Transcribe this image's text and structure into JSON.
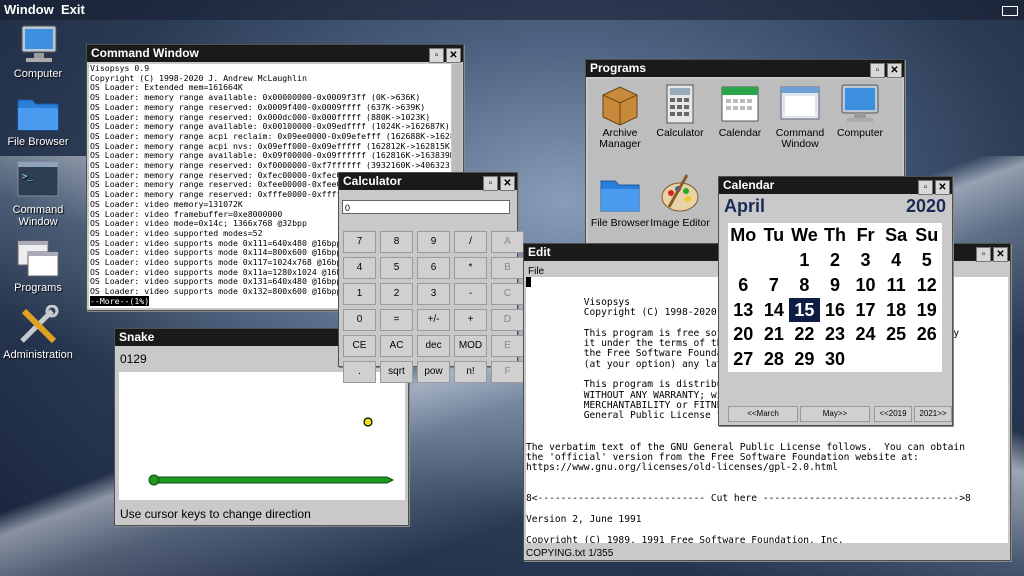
{
  "topbar": {
    "window_label": "Window",
    "exit_label": "Exit"
  },
  "desktop_icons": [
    {
      "label": "Computer"
    },
    {
      "label": "File Browser"
    },
    {
      "label": "Command Window"
    },
    {
      "label": "Programs"
    },
    {
      "label": "Administration"
    }
  ],
  "cmd": {
    "title": "Command Window",
    "lines": [
      "Visopsys 0.9",
      "Copyright (C) 1998-2020 J. Andrew McLaughlin",
      "OS Loader: Extended mem=161664K",
      "OS Loader: memory range available: 0x00000000-0x0009f3ff (0K->636K)",
      "OS Loader: memory range reserved: 0x0009f400-0x0009ffff (637K->639K)",
      "OS Loader: memory range reserved: 0x000dc000-0x000fffff (880K->1023K)",
      "OS Loader: memory range available: 0x00100000-0x09edffff (1024K->162687K)",
      "OS Loader: memory range acpi reclaim: 0x09ee0000-0x09efefff (162688K->162811K)",
      "OS Loader: memory range acpi nvs: 0x09eff000-0x09efffff (162812K->162815K)",
      "OS Loader: memory range available: 0x09f00000-0x09ffffff (162816K->163839K)",
      "OS Loader: memory range reserved: 0xf0000000-0xf7ffffff (3932160K->4063231K)",
      "OS Loader: memory range reserved: 0xfec00000-0xfec0ffff",
      "OS Loader: memory range reserved: 0xfee00000-0xfee00fff",
      "OS Loader: memory range reserved: 0xfffe0000-0xffffffff",
      "OS Loader: video memory=131072K",
      "OS Loader: video framebuffer=0xe8000000",
      "OS Loader: video mode=0x14c; 1366x768 @32bpp",
      "OS Loader: video supported modes=52",
      "OS Loader: video supports mode 0x111=640x480 @16bpp",
      "OS Loader: video supports mode 0x114=800x600 @16bpp",
      "OS Loader: video supports mode 0x117=1024x768 @16bpp",
      "OS Loader: video supports mode 0x11a=1280x1024 @16bpp",
      "OS Loader: video supports mode 0x131=640x480 @16bpp",
      "OS Loader: video supports mode 0x132=800x600 @16bpp"
    ],
    "more": "--More--(1%)"
  },
  "snake": {
    "title": "Snake",
    "score": "0129",
    "tip": "Use cursor keys to change direction"
  },
  "calc": {
    "title": "Calculator",
    "display": "0",
    "keys": [
      "7",
      "8",
      "9",
      "/",
      "A",
      "4",
      "5",
      "6",
      "*",
      "B",
      "1",
      "2",
      "3",
      "-",
      "C",
      "0",
      "=",
      "+/-",
      "+",
      "D",
      "CE",
      "AC",
      "dec",
      "MOD",
      "E",
      ".",
      "sqrt",
      "pow",
      "n!",
      "F"
    ]
  },
  "programs": {
    "title": "Programs",
    "items": [
      "Archive Manager",
      "Calculator",
      "Calendar",
      "Command Window",
      "Computer",
      "File Browser",
      "Image Editor"
    ]
  },
  "edit": {
    "title": "Edit",
    "menu_file": "File",
    "lines": [
      "",
      "          Visopsys",
      "          Copyright (C) 1998-2020",
      "",
      "          This program is free sof                                   modify",
      "          it under the terms of th                                   ed by",
      "          the Free Software Foundat                                  or",
      "          (at your option) any lat",
      "",
      "          This program is distribu                                   but",
      "          WITHOUT ANY WARRANTY; wi",
      "          MERCHANTABILITY or FITNE                                   U",
      "          General Public License f",
      "",
      "",
      "The verbatim text of the GNU General Public License follows.  You can obtain",
      "the 'official' version from the Free Software Foundation website at:",
      "https://www.gnu.org/licenses/old-licenses/gpl-2.0.html",
      "",
      "",
      "8<----------------------------- Cut here ---------------------------------->8",
      "",
      "Version 2, June 1991",
      "",
      "Copyright (C) 1989, 1991 Free Software Foundation, Inc."
    ],
    "status": "COPYING.txt 1/355"
  },
  "calendar": {
    "title": "Calendar",
    "month": "April",
    "year": "2020",
    "days": [
      "Mo",
      "Tu",
      "We",
      "Th",
      "Fr",
      "Sa",
      "Su"
    ],
    "dates": [
      "",
      "",
      "1",
      "2",
      "3",
      "4",
      "5",
      "6",
      "7",
      "8",
      "9",
      "10",
      "11",
      "12",
      "13",
      "14",
      "15",
      "16",
      "17",
      "18",
      "19",
      "20",
      "21",
      "22",
      "23",
      "24",
      "25",
      "26",
      "27",
      "28",
      "29",
      "30",
      "",
      "",
      "",
      "",
      ""
    ],
    "selected": "15",
    "nav": [
      "<<March",
      "May>>",
      "<<2019",
      "2021>>"
    ]
  },
  "colors": {
    "titlebar": "#1a1a1a",
    "snake": "#1e9b1e",
    "calendar_accent": "#0d1d44"
  }
}
